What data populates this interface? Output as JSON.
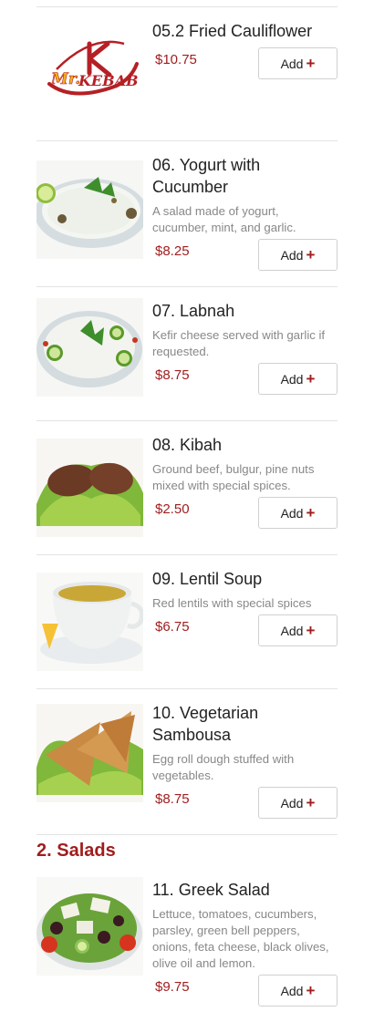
{
  "menu": {
    "items": [
      {
        "title": "05.2 Fried Cauliflower",
        "description": "",
        "price": "$10.75",
        "add_label": "Add",
        "image": "logo-placeholder"
      },
      {
        "title": "06. Yogurt with Cucumber",
        "description": "A salad made of yogurt, cucumber, mint, and garlic.",
        "price": "$8.25",
        "add_label": "Add",
        "image": "yogurt-cucumber-photo"
      },
      {
        "title": "07. Labnah",
        "description": "Kefir cheese served with garlic if requested.",
        "price": "$8.75",
        "add_label": "Add",
        "image": "labnah-photo"
      },
      {
        "title": "08. Kibah",
        "description": "Ground beef, bulgur, pine nuts mixed with special spices.",
        "price": "$2.50",
        "add_label": "Add",
        "image": "kibah-photo"
      },
      {
        "title": "09. Lentil Soup",
        "description": "Red lentils with special spices",
        "price": "$6.75",
        "add_label": "Add",
        "image": "lentil-soup-photo"
      },
      {
        "title": "10. Vegetarian Sambousa",
        "description": "Egg roll dough stuffed with vegetables.",
        "price": "$8.75",
        "add_label": "Add",
        "image": "sambousa-photo"
      }
    ],
    "section": "2. Salads",
    "salad_items": [
      {
        "title": "11. Greek Salad",
        "description": "Lettuce, tomatoes, cucumbers, parsley, green bell peppers, onions, feta cheese, black olives, olive oil and lemon.",
        "price": "$9.75",
        "add_label": "Add",
        "image": "greek-salad-photo"
      }
    ]
  },
  "logo": {
    "text_my": "Mr.",
    "text_kebab": "KEBAB"
  },
  "icons": {
    "camera": "camera-icon",
    "plus": "plus-icon"
  },
  "colors": {
    "accent": "#a01e1e",
    "text": "#222222",
    "muted": "#888888",
    "divider": "#e3e3e3"
  }
}
